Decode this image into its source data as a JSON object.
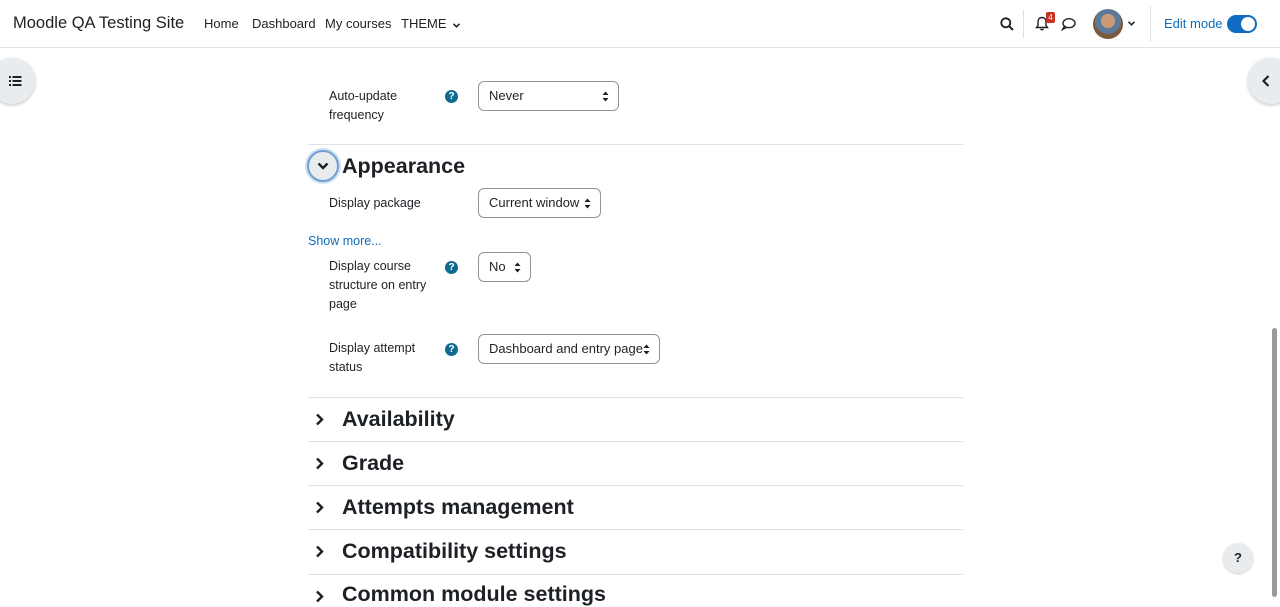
{
  "navbar": {
    "brand": "Moodle QA Testing Site",
    "links": [
      "Home",
      "Dashboard",
      "My courses",
      "THEME"
    ],
    "notification_count": "4",
    "edit_mode_label": "Edit mode"
  },
  "form": {
    "auto_update": {
      "label": "Auto-update frequency",
      "value": "Never"
    },
    "appearance": {
      "heading": "Appearance",
      "display_package": {
        "label": "Display package",
        "value": "Current window"
      },
      "show_more": "Show more...",
      "course_structure": {
        "label": "Display course structure on entry page",
        "value": "No"
      },
      "attempt_status": {
        "label": "Display attempt status",
        "value": "Dashboard and entry page"
      }
    },
    "sections": [
      "Availability",
      "Grade",
      "Attempts management",
      "Compatibility settings",
      "Common module settings"
    ]
  },
  "help_button": "?",
  "colors": {
    "accent": "#0f6cbf",
    "help_icon": "#0f6c8f",
    "badge": "#ca3120"
  }
}
